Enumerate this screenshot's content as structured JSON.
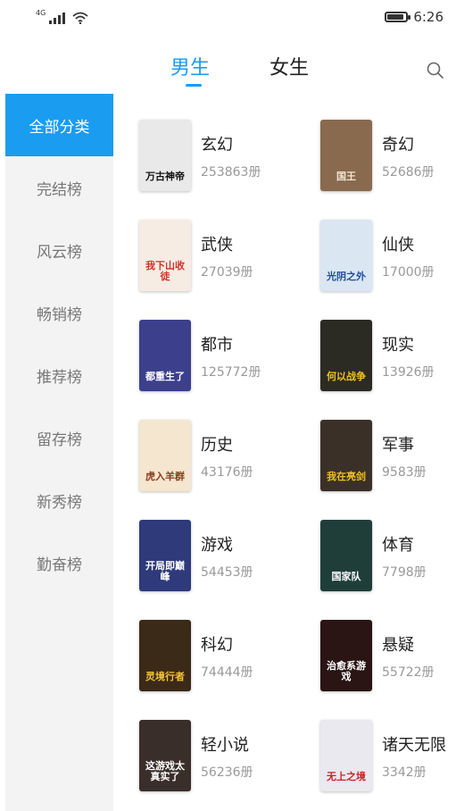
{
  "status": {
    "network": "4G",
    "time": "6:26",
    "battery_level": 0.9
  },
  "tabs": {
    "male": "男生",
    "female": "女生"
  },
  "sidebar": {
    "items": [
      {
        "label": "全部分类"
      },
      {
        "label": "完结榜"
      },
      {
        "label": "风云榜"
      },
      {
        "label": "畅销榜"
      },
      {
        "label": "推荐榜"
      },
      {
        "label": "留存榜"
      },
      {
        "label": "新秀榜"
      },
      {
        "label": "勤奋榜"
      }
    ]
  },
  "categories": [
    {
      "name": "玄幻",
      "count": "253863册",
      "cover_text": "万古神帝",
      "cover_bg": "#e9e9e9",
      "cover_fg": "#111111"
    },
    {
      "name": "奇幻",
      "count": "52686册",
      "cover_text": "国王",
      "cover_bg": "#8a6a4f",
      "cover_fg": "#f2e5d0"
    },
    {
      "name": "武侠",
      "count": "27039册",
      "cover_text": "我下山收徒",
      "cover_bg": "#f6ece4",
      "cover_fg": "#d1322c"
    },
    {
      "name": "仙侠",
      "count": "17000册",
      "cover_text": "光阴之外",
      "cover_bg": "#dbe6f3",
      "cover_fg": "#1f4e9c"
    },
    {
      "name": "都市",
      "count": "125772册",
      "cover_text": "都重生了",
      "cover_bg": "#3c3f8c",
      "cover_fg": "#ffffff"
    },
    {
      "name": "现实",
      "count": "13926册",
      "cover_text": "何以战争",
      "cover_bg": "#2b2b24",
      "cover_fg": "#f0c020"
    },
    {
      "name": "历史",
      "count": "43176册",
      "cover_text": "虎入羊群",
      "cover_bg": "#f4e6cf",
      "cover_fg": "#8a3a1a"
    },
    {
      "name": "军事",
      "count": "9583册",
      "cover_text": "我在亮剑",
      "cover_bg": "#3a3028",
      "cover_fg": "#f0c020"
    },
    {
      "name": "游戏",
      "count": "54453册",
      "cover_text": "开局即巅峰",
      "cover_bg": "#2e3a7a",
      "cover_fg": "#ffffff"
    },
    {
      "name": "体育",
      "count": "7798册",
      "cover_text": "国家队",
      "cover_bg": "#1f3e3a",
      "cover_fg": "#ffffff"
    },
    {
      "name": "科幻",
      "count": "74444册",
      "cover_text": "灵境行者",
      "cover_bg": "#3b2a18",
      "cover_fg": "#f5c43a"
    },
    {
      "name": "悬疑",
      "count": "55722册",
      "cover_text": "治愈系游戏",
      "cover_bg": "#2a1414",
      "cover_fg": "#ffffff"
    },
    {
      "name": "轻小说",
      "count": "56236册",
      "cover_text": "这游戏太真实了",
      "cover_bg": "#3a2e2a",
      "cover_fg": "#ffffff"
    },
    {
      "name": "诸天无限",
      "count": "3342册",
      "cover_text": "无上之境",
      "cover_bg": "#e9e9ef",
      "cover_fg": "#c0282a"
    }
  ]
}
